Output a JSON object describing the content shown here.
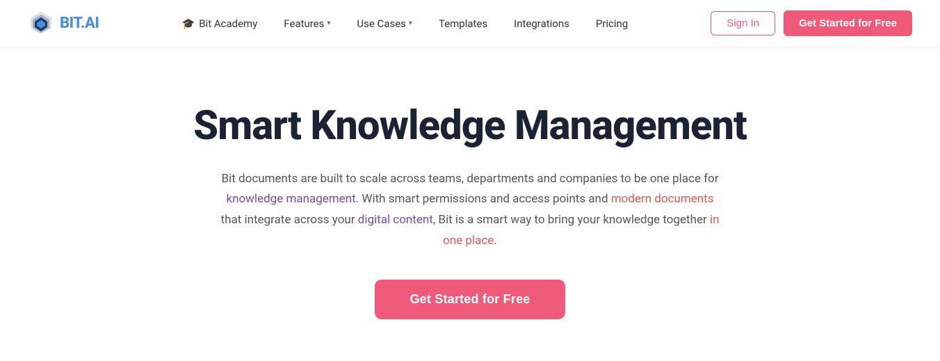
{
  "logo": {
    "brand_first": "BIT",
    "brand_second": ".AI",
    "alt": "Bit.ai logo"
  },
  "nav": {
    "links": [
      {
        "id": "bit-academy",
        "label": "Bit Academy",
        "has_chevron": false,
        "has_icon": true
      },
      {
        "id": "features",
        "label": "Features",
        "has_chevron": true,
        "has_icon": false
      },
      {
        "id": "use-cases",
        "label": "Use Cases",
        "has_chevron": true,
        "has_icon": false
      },
      {
        "id": "templates",
        "label": "Templates",
        "has_chevron": false,
        "has_icon": false
      },
      {
        "id": "integrations",
        "label": "Integrations",
        "has_chevron": false,
        "has_icon": false
      },
      {
        "id": "pricing",
        "label": "Pricing",
        "has_chevron": false,
        "has_icon": false
      }
    ],
    "signin_label": "Sign In",
    "cta_label": "Get Started for Free"
  },
  "hero": {
    "title": "Smart Knowledge Management",
    "subtitle_full": "Bit documents are built to scale across teams, departments and companies to be one place for knowledge management. With smart permissions and access points and modern documents that integrate across your digital content, Bit is a smart way to bring your knowledge together in one place.",
    "cta_label": "Get Started for Free"
  },
  "colors": {
    "brand_pink": "#f05a7a",
    "brand_purple": "#6b4fbb",
    "brand_red": "#e05a5a",
    "nav_text": "#333333",
    "hero_title": "#1a2233",
    "hero_subtitle": "#555555"
  }
}
